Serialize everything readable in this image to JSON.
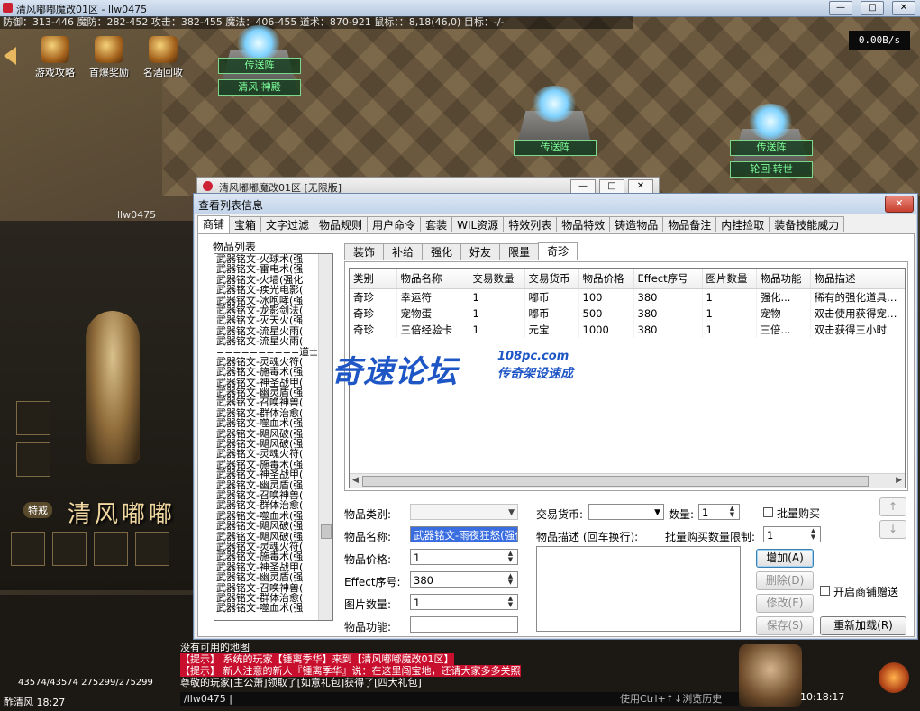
{
  "window": {
    "title": "清风嘟嘟魔改01区 - llw0475",
    "controls": [
      "—",
      "□",
      "✕"
    ]
  },
  "hud": {
    "stats": "防御：313-446  魔防：282-452  攻击：382-455  魔法：406-455  道术：870-921  鼠标：：8,18(46,0)  目标：-/-",
    "net_speed": "0.00B/s",
    "top_icons": [
      "游戏攻略",
      "首爆奖励",
      "名酒回收"
    ],
    "portal_labels": [
      "传送阵",
      "清风·神殿",
      "传送阵",
      "传送阵",
      "轮回·转世"
    ],
    "player_name": "llw0475",
    "left_tag": "特戒",
    "brand": "清风嘟嘟",
    "hp_line": "43574/43574 275299/275299",
    "bottom_name": "酢清风  18:27",
    "bottom_time": "10:18:17",
    "chat_lines": [
      "没有可用的地图",
      "【提示】 系统的玩家【锺离季华】来到【清风嘟嘟魔改01区】",
      "【提示】 新人注意的新人『锺离季华』说：在这里闯宝地，还请大家多多关照",
      "尊敬的玩家[主公萧]领取了[如意礼包]获得了[四大礼包]"
    ],
    "chat_input": "/llw0475 |",
    "chat_hint": "使用Ctrl+↑↓浏览历史"
  },
  "back_window": {
    "title": "清风嘟嘟魔改01区 [无限版]",
    "controls": [
      "—",
      "□",
      "✕"
    ]
  },
  "dialog": {
    "title": "查看列表信息",
    "close": "✕",
    "tabs": [
      "商铺",
      "宝箱",
      "文字过滤",
      "物品规则",
      "用户命令",
      "套装",
      "WIL资源",
      "特效列表",
      "物品特效",
      "铸造物品",
      "物品备注",
      "内挂捡取",
      "装备技能威力"
    ],
    "active_tab": "商铺",
    "item_list_label": "物品列表",
    "item_list": [
      "武器铭文-火球术(强",
      "武器铭文-雷电术(强",
      "武器铭文-火墙(强化",
      "武器铭文-疾光电影(",
      "武器铭文-冰咆哮(强",
      "武器铭文-龙影剑法(",
      "武器铭文-灭天火(强",
      "武器铭文-流星火雨(",
      "武器铭文-流星火雨(",
      "==========道士铭文",
      "武器铭文-灵魂火符(",
      "武器铭文-施毒术(强",
      "武器铭文-神圣战甲(",
      "武器铭文-幽灵盾(强",
      "武器铭文-召唤神兽(",
      "武器铭文-群体治愈(",
      "武器铭文-噬血术(强",
      "武器铭文-飓风破(强",
      "武器铭文-飓风破(强",
      "武器铭文-灵魂火符(",
      "武器铭文-施毒术(强",
      "武器铭文-神圣战甲(",
      "武器铭文-幽灵盾(强",
      "武器铭文-召唤神兽(",
      "武器铭文-群体治愈(",
      "武器铭文-噬血术(强",
      "武器铭文-飓风破(强",
      "武器铭文-飓风破(强",
      "武器铭文-灵魂火符(",
      "武器铭文-施毒术(强",
      "武器铭文-神圣战甲(",
      "武器铭文-幽灵盾(强",
      "武器铭文-召唤神兽(",
      "武器铭文-群体治愈(",
      "武器铭文-噬血术(强"
    ],
    "sub_tabs": [
      "装饰",
      "补给",
      "强化",
      "好友",
      "限量",
      "奇珍"
    ],
    "active_sub_tab": "奇珍",
    "table_headers": [
      "类别",
      "物品名称",
      "交易数量",
      "交易货币",
      "物品价格",
      "Effect序号",
      "图片数量",
      "物品功能",
      "物品描述"
    ],
    "table_rows": [
      [
        "奇珍",
        "幸运符",
        "1",
        "嘟币",
        "100",
        "380",
        "1",
        "强化...",
        "稀有的强化道具防..."
      ],
      [
        "奇珍",
        "宠物蛋",
        "1",
        "嘟币",
        "500",
        "380",
        "1",
        "宠物",
        "双击使用获得宠物..."
      ],
      [
        "奇珍",
        "三倍经验卡",
        "1",
        "元宝",
        "1000",
        "380",
        "1",
        "三倍...",
        "双击获得三小时"
      ]
    ],
    "watermark": {
      "main": "奇速论坛",
      "url": "108pc.com",
      "slogan": "传奇架设速成"
    },
    "form": {
      "category_label": "物品类别:",
      "category_value": "",
      "name_label": "物品名称:",
      "name_value": "武器铭文-雨夜狂怒(强化)",
      "price_label": "物品价格:",
      "price_value": "1",
      "effect_label": "Effect序号:",
      "effect_value": "380",
      "image_count_label": "图片数量:",
      "image_count_value": "1",
      "function_label": "物品功能:",
      "function_value": "",
      "currency_label": "交易货币:",
      "currency_value": "",
      "quantity_label": "数量:",
      "quantity_value": "1",
      "batch_buy_label": "批量购买",
      "desc_label": "物品描述  (回车换行):",
      "batch_limit_label": "批量购买数量限制:",
      "batch_limit_value": "1",
      "add_button": "增加(A)",
      "delete_button": "删除(D)",
      "modify_button": "修改(E)",
      "save_button": "保存(S)",
      "reload_button": "重新加载(R)",
      "gift_label": "开启商铺赠送",
      "up_arrow": "↑",
      "down_arrow": "↓"
    }
  }
}
